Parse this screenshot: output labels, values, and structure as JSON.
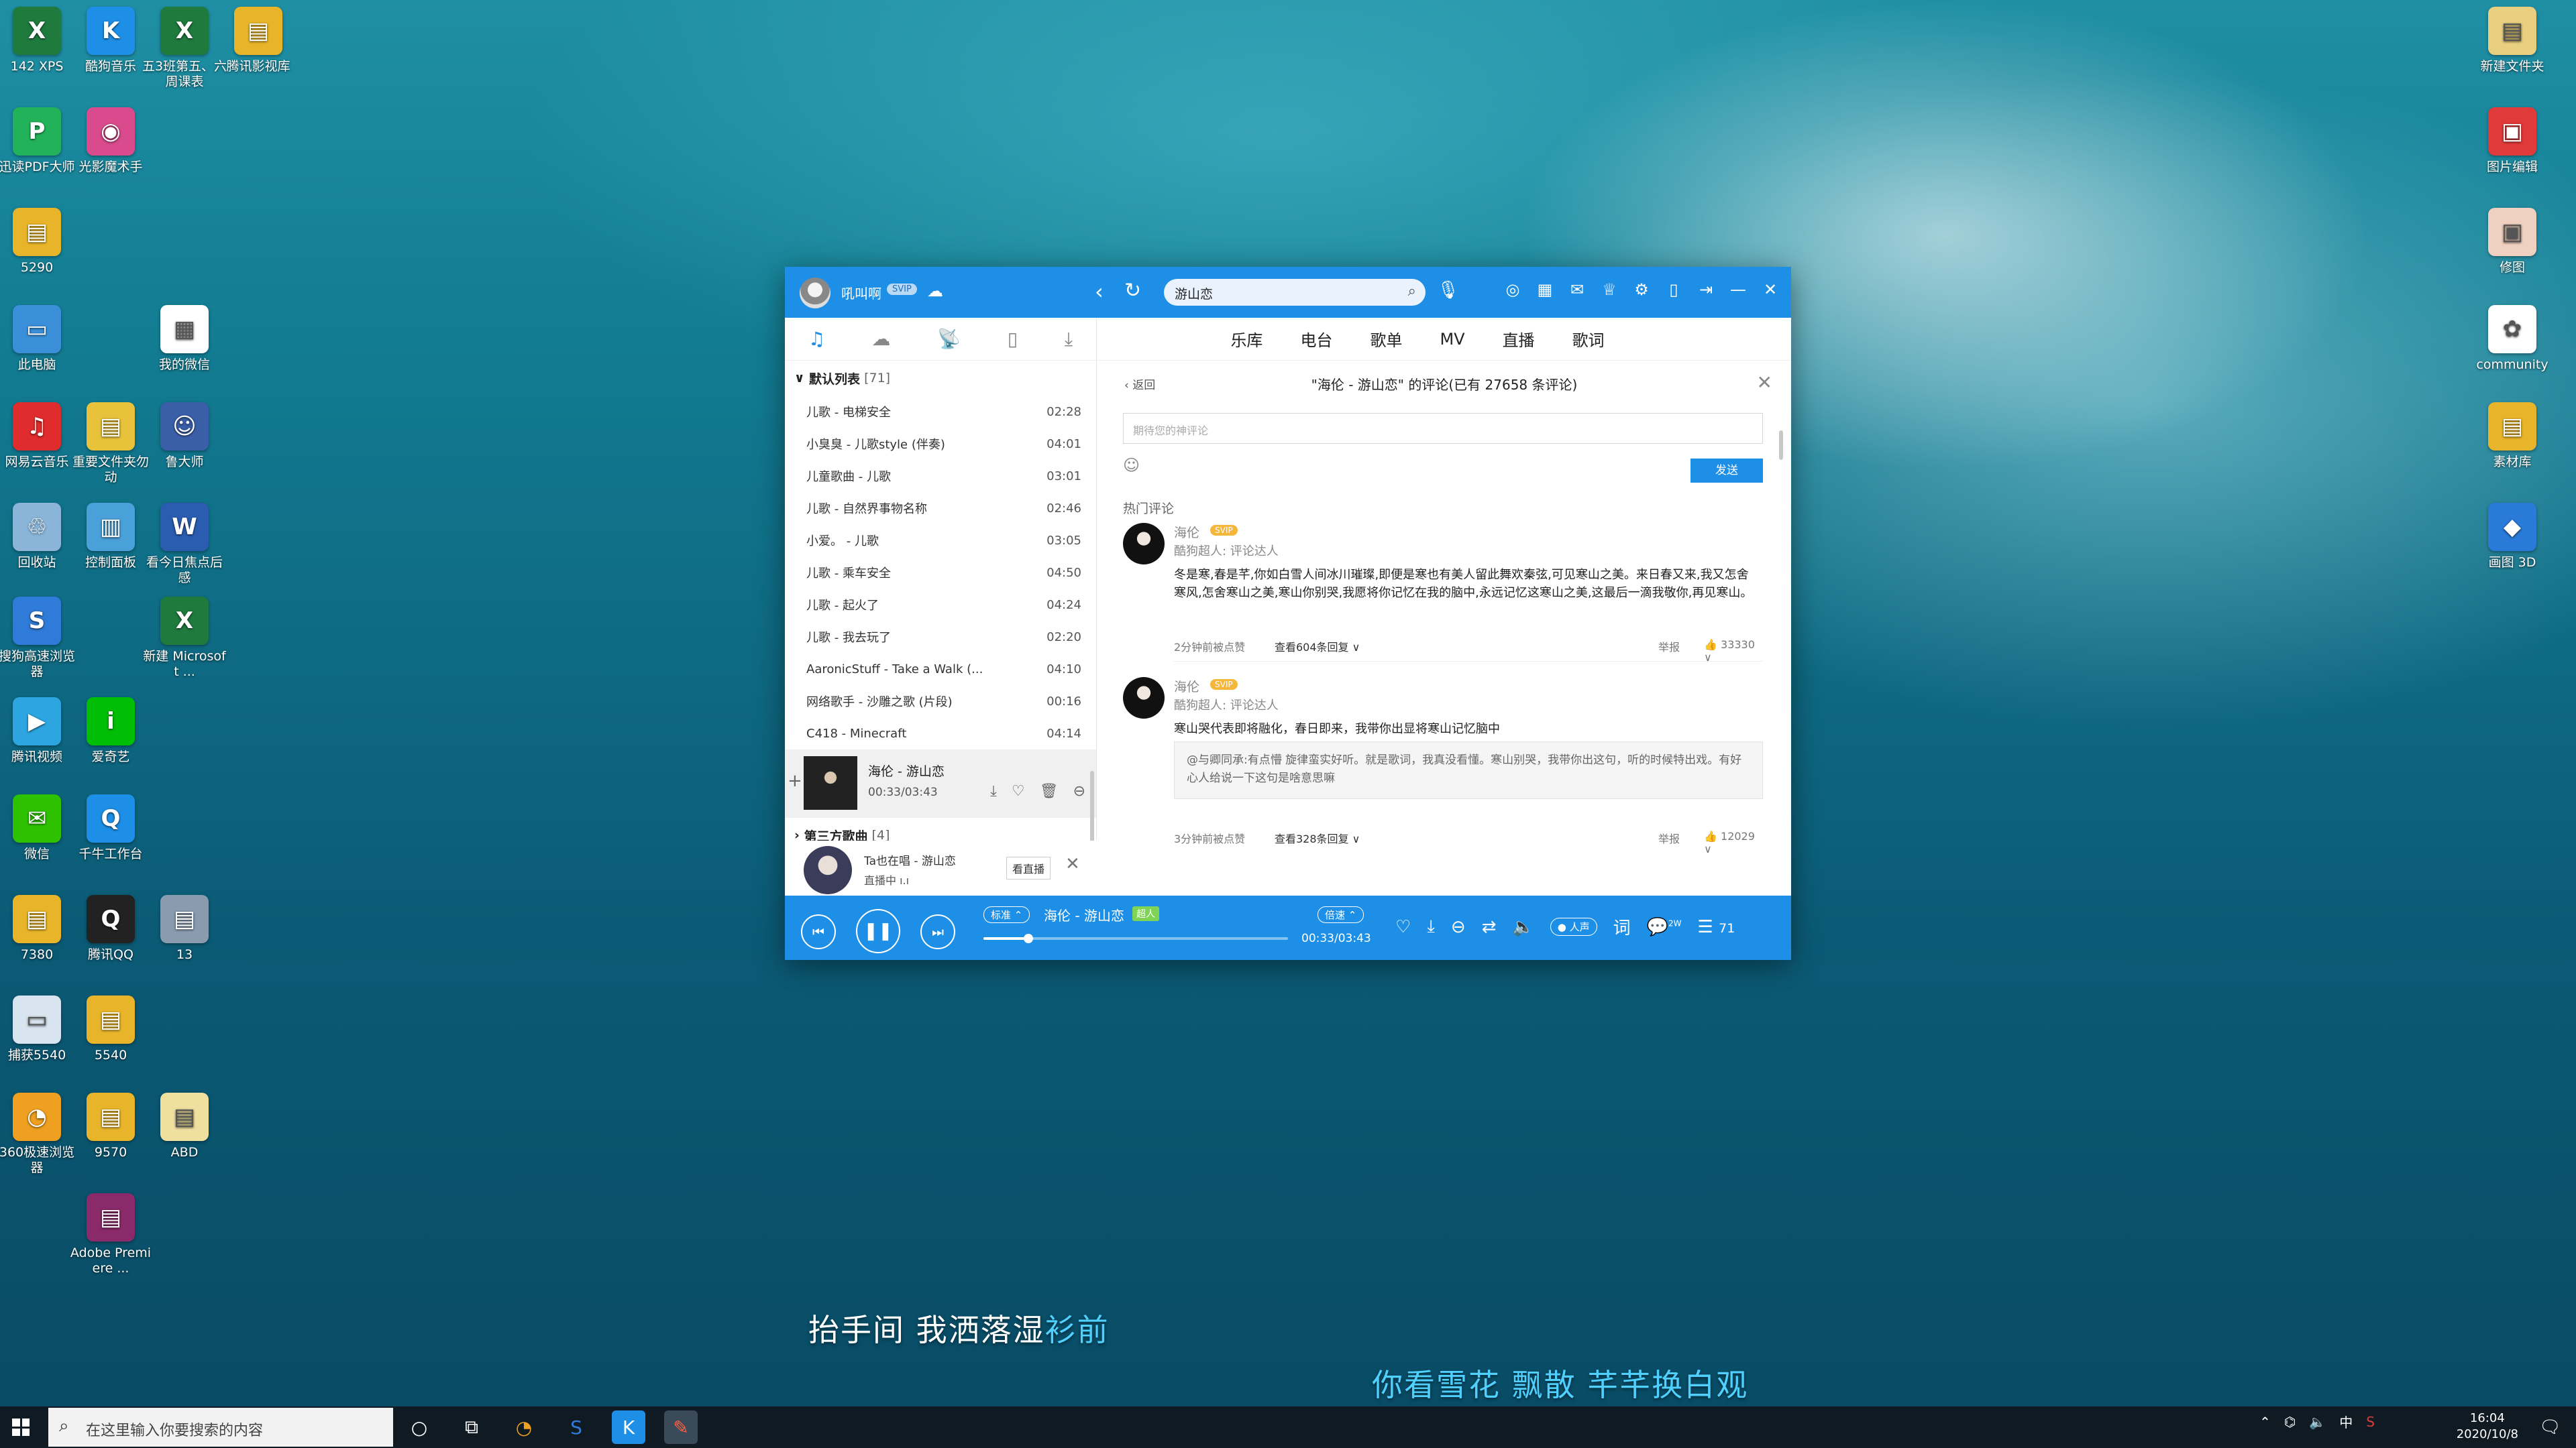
{
  "desktop_icons": [
    {
      "label": "142 XPS",
      "icon": "excel-file-icon",
      "color": "#1f7a3e",
      "glyph": "X"
    },
    {
      "label": "酷狗音乐",
      "icon": "kugou-icon",
      "color": "#1e8fe6",
      "glyph": "K"
    },
    {
      "label": "五3班第五、六周课表",
      "icon": "excel-file-icon",
      "color": "#1f7a3e",
      "glyph": "X"
    },
    {
      "label": "腾讯影视库",
      "icon": "folder-icon",
      "color": "#e8b52a",
      "glyph": "▤"
    },
    {
      "label": "迅读PDF大师",
      "icon": "pdf-icon",
      "color": "#22b35a",
      "glyph": "P"
    },
    {
      "label": "光影魔术手",
      "icon": "camera-app-icon",
      "color": "#d94b8c",
      "glyph": "◉"
    },
    {
      "label": "5290",
      "icon": "document-icon",
      "color": "#e8b52a",
      "glyph": "▤"
    },
    {
      "label": "此电脑",
      "icon": "computer-icon",
      "color": "#3a8fd8",
      "glyph": "▭"
    },
    {
      "label": "我的微信",
      "icon": "qr-code-icon",
      "color": "#ffffff",
      "glyph": "▦"
    },
    {
      "label": "网易云音乐",
      "icon": "netease-music-icon",
      "color": "#e02c2c",
      "glyph": "♫"
    },
    {
      "label": "重要文件夹勿动",
      "icon": "folder-icon",
      "color": "#e8c23a",
      "glyph": "▤"
    },
    {
      "label": "鲁大师",
      "icon": "ludashi-icon",
      "color": "#3a5fa8",
      "glyph": "☺"
    },
    {
      "label": "回收站",
      "icon": "recycle-bin-icon",
      "color": "#8ab5d8",
      "glyph": "♲"
    },
    {
      "label": "控制面板",
      "icon": "control-panel-icon",
      "color": "#4aa0d8",
      "glyph": "▥"
    },
    {
      "label": "看今日焦点后感",
      "icon": "word-file-icon",
      "color": "#2a5db0",
      "glyph": "W"
    },
    {
      "label": "搜狗高速浏览器",
      "icon": "sogou-browser-icon",
      "color": "#2f7bd9",
      "glyph": "S"
    },
    {
      "label": "新建 Microsoft ...",
      "icon": "excel-file-icon",
      "color": "#1f7a3e",
      "glyph": "X"
    },
    {
      "label": "腾讯视频",
      "icon": "tencent-video-icon",
      "color": "#2ca5e0",
      "glyph": "▶"
    },
    {
      "label": "爱奇艺",
      "icon": "iqiyi-icon",
      "color": "#00be06",
      "glyph": "i"
    },
    {
      "label": "微信",
      "icon": "wechat-icon",
      "color": "#2dc100",
      "glyph": "✉"
    },
    {
      "label": "千牛工作台",
      "icon": "qianniu-icon",
      "color": "#1e8fe6",
      "glyph": "Q"
    },
    {
      "label": "7380",
      "icon": "document-icon",
      "color": "#e8b52a",
      "glyph": "▤"
    },
    {
      "label": "腾讯QQ",
      "icon": "qq-icon",
      "color": "#222222",
      "glyph": "Q"
    },
    {
      "label": "13",
      "icon": "document-icon",
      "color": "#8a9bb0",
      "glyph": "▤"
    },
    {
      "label": "捕获5540",
      "icon": "image-file-icon",
      "color": "#d8e4f0",
      "glyph": "▭"
    },
    {
      "label": "5540",
      "icon": "document-icon",
      "color": "#e8b52a",
      "glyph": "▤"
    },
    {
      "label": "360极速浏览器",
      "icon": "360-browser-icon",
      "color": "#f0a020",
      "glyph": "◔"
    },
    {
      "label": "9570",
      "icon": "document-icon",
      "color": "#e8b52a",
      "glyph": "▤"
    },
    {
      "label": "ABD",
      "icon": "document-icon",
      "color": "#f0e0a0",
      "glyph": "▤"
    },
    {
      "label": "Adobe Premiere ...",
      "icon": "winrar-icon",
      "color": "#8a2a6a",
      "glyph": "▤"
    },
    {
      "label": "新建文件夹",
      "icon": "document-icon",
      "color": "#e8d080",
      "glyph": "▤"
    },
    {
      "label": "图片编辑",
      "icon": "picture-editor-icon",
      "color": "#e03a3a",
      "glyph": "▣"
    },
    {
      "label": "修图",
      "icon": "image-file-icon",
      "color": "#f0d0c0",
      "glyph": "▣"
    },
    {
      "label": "community",
      "icon": "community-icon",
      "color": "#ffffff",
      "glyph": "✿"
    },
    {
      "label": "素材库",
      "icon": "document-icon",
      "color": "#e8b52a",
      "glyph": "▤"
    },
    {
      "label": "画图 3D",
      "icon": "paint3d-icon",
      "color": "#2a7ad8",
      "glyph": "◆"
    }
  ],
  "player": {
    "user": {
      "name": "吼叫啊",
      "badge": "SVIP"
    },
    "search": {
      "value": "游山恋"
    },
    "left_tabs": [
      "music-note-icon",
      "cloud-icon",
      "radio-icon",
      "device-icon",
      "download-icon"
    ],
    "default_list": {
      "title": "默认列表",
      "count": "[71]"
    },
    "songs": [
      {
        "title": "儿歌 - 电梯安全",
        "duration": "02:28"
      },
      {
        "title": "小臭臭 - 儿歌style (伴奏)",
        "duration": "04:01"
      },
      {
        "title": "儿童歌曲 - 儿歌",
        "duration": "03:01"
      },
      {
        "title": "儿歌 - 自然界事物名称",
        "duration": "02:46"
      },
      {
        "title": "小爱。 - 儿歌",
        "duration": "03:05"
      },
      {
        "title": "儿歌 - 乘车安全",
        "duration": "04:50"
      },
      {
        "title": "儿歌 - 起火了",
        "duration": "04:24"
      },
      {
        "title": "儿歌 - 我去玩了",
        "duration": "02:20"
      },
      {
        "title": "AaronicStuff - Take a Walk (...",
        "duration": "04:10"
      },
      {
        "title": "网络歌手 - 沙雕之歌 (片段)",
        "duration": "00:16"
      },
      {
        "title": "C418 - Minecraft",
        "duration": "04:14"
      }
    ],
    "now_playing": {
      "title": "海伦 - 游山恋",
      "time": "00:33/03:43"
    },
    "third_party": {
      "title": "第三方歌曲",
      "count": "[4]"
    },
    "live": {
      "line1": "Ta也在唱 - 游山恋",
      "line2": "直播中 ı.ı",
      "button": "看直播"
    },
    "main_tabs": [
      "乐库",
      "电台",
      "歌单",
      "MV",
      "直播",
      "歌词"
    ],
    "comments_panel": {
      "back": "返回",
      "title": "\"海伦 - 游山恋\" 的评论(已有 27658 条评论)",
      "input_placeholder": "期待您的神评论",
      "send": "发送",
      "hot_label": "热门评论",
      "items": [
        {
          "name": "海伦",
          "badge": "SVIP",
          "role": "酷狗超人: 评论达人",
          "text": "冬是寒,春是芊,你如白雪人间冰川璀璨,即便是寒也有美人留此舞欢秦弦,可见寒山之美。来日春又来,我又怎舍寒风,怎舍寒山之美,寒山你别哭,我愿将你记忆在我的脑中,永远记忆这寒山之美,这最后一滴我敬你,再见寒山。",
          "time": "2分钟前被点赞",
          "replies": "查看604条回复",
          "report": "举报",
          "likes": "33330"
        },
        {
          "name": "海伦",
          "badge": "SVIP",
          "role": "酷狗超人: 评论达人",
          "text": "寒山哭代表即将融化，春日即来，我带你出显将寒山记忆脑中",
          "quote": "@与卿同承:有点懵 旋律蛮实好听。就是歌词，我真没看懂。寒山别哭，我带你出这句，听的时候特出戏。有好心人给说一下这句是啥意思嘛",
          "time": "3分钟前被点赞",
          "replies": "查看328条回复",
          "report": "举报",
          "likes": "12029"
        }
      ]
    },
    "playbar": {
      "quality": "标准",
      "song": "海伦 - 游山恋",
      "tag": "超人",
      "progress": 0.148,
      "speed": "倍速",
      "time": "00:33/03:43",
      "voice": "人声",
      "lyrics_btn": "词",
      "comment_count": "2W",
      "playlist_count": "71"
    }
  },
  "desktop_lyrics": {
    "line1_sung": "抬手间  我洒落湿",
    "line1_rest": "衫前",
    "line2": "你看雪花  飘散  芊芊换白观"
  },
  "taskbar": {
    "search_placeholder": "在这里输入你要搜索的内容",
    "time": "16:04",
    "date": "2020/10/8",
    "ime": "中"
  }
}
